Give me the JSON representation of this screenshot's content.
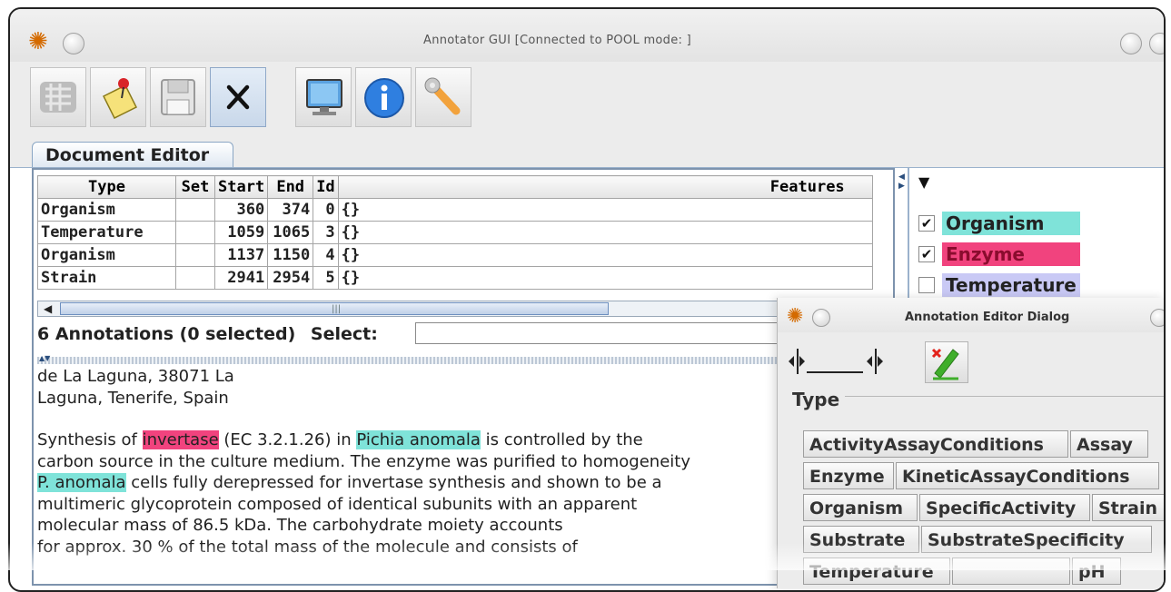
{
  "window": {
    "title": "Annotator GUI [Connected to POOL mode:         ]"
  },
  "toolbar": {
    "buttons": [
      {
        "icon": "graph-icon"
      },
      {
        "icon": "note-pin-icon"
      },
      {
        "icon": "save-icon"
      },
      {
        "icon": "close-icon"
      },
      {
        "icon": "monitor-icon"
      },
      {
        "icon": "info-icon"
      },
      {
        "icon": "wrench-icon"
      }
    ]
  },
  "tab": {
    "label": "Document Editor"
  },
  "table": {
    "headers": [
      "Type",
      "Set",
      "Start",
      "End",
      "Id",
      "Features"
    ],
    "rows": [
      {
        "type": "Organism",
        "set": "",
        "start": "360",
        "end": "374",
        "id": "0",
        "features": "{}"
      },
      {
        "type": "Temperature",
        "set": "",
        "start": "1059",
        "end": "1065",
        "id": "3",
        "features": "{}"
      },
      {
        "type": "Organism",
        "set": "",
        "start": "1137",
        "end": "1150",
        "id": "4",
        "features": "{}"
      },
      {
        "type": "Strain",
        "set": "",
        "start": "2941",
        "end": "2954",
        "id": "5",
        "features": "{}"
      }
    ]
  },
  "status": {
    "annotations_text": "6 Annotations (0 selected)",
    "select_label": "Select:",
    "select_value": ""
  },
  "text": {
    "line1": "de La Laguna, 38071 La",
    "line2": "Laguna, Tenerife, Spain",
    "p_pre": "Synthesis of ",
    "p_enzyme": "invertase",
    "p_mid": " (EC 3.2.1.26) in ",
    "p_org": "Pichia anomala",
    "p_post": " is controlled by the",
    "line4": "carbon source in the culture medium. The enzyme was purified to homogeneity",
    "line5_org": "P. anomala",
    "line5_post": " cells fully derepressed for invertase synthesis and shown to be a",
    "line6": "multimeric glycoprotein composed of identical subunits with an apparent",
    "line7": "molecular mass of 86.5 kDa. The carbohydrate moiety accounts",
    "line8": "for approx. 30 % of the total mass of the molecule and consists of"
  },
  "legend": {
    "items": [
      {
        "label": "Organism",
        "checked": "✔",
        "color": "#7fe3d9"
      },
      {
        "label": "Enzyme",
        "checked": "✔",
        "color": "#f1437e"
      },
      {
        "label": "Temperature",
        "checked": "",
        "color": "#c9c9f5"
      }
    ]
  },
  "dialog": {
    "title": "Annotation Editor Dialog",
    "type_label": "Type",
    "types": [
      "ActivityAssayConditions",
      "Assay",
      "Enzyme",
      "KineticAssayConditions",
      "Organism",
      "SpecificActivity",
      "Strain",
      "Substrate",
      "SubstrateSpecificity",
      "Temperature",
      "",
      "pH"
    ]
  }
}
